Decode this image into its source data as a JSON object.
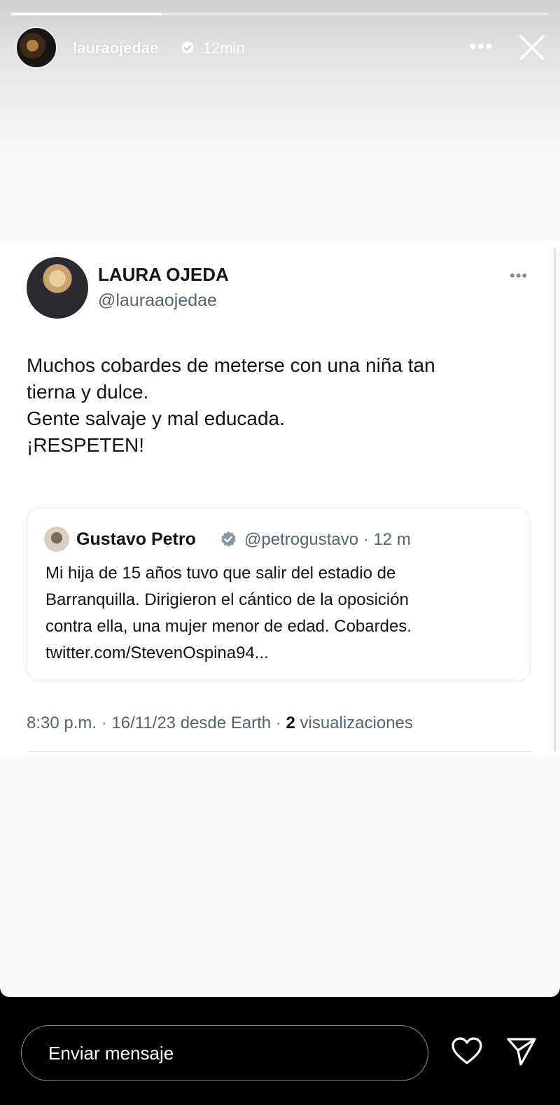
{
  "story": {
    "username": "lauraojedae",
    "time": "12min",
    "progress": 0.28,
    "more_icon": "more-horizontal-icon",
    "close_icon": "close-icon"
  },
  "tweet": {
    "author_name": "LAURA OJEDA",
    "author_handle": "@lauraaojedae",
    "text_lines": [
      "Muchos cobardes de meterse con una niña tan",
      "tierna y dulce.",
      "Gente salvaje y mal educada.",
      "¡RESPETEN!"
    ],
    "quote": {
      "name": "Gustavo Petro",
      "handle_time": "@petrogustavo · 12 m",
      "text_lines": [
        "Mi hija de 15 años tuvo que salir del estadio de",
        "Barranquilla. Dirigieron el cántico de la oposición",
        "contra ella, una mujer menor de edad. Cobardes.",
        "twitter.com/StevenOspina94..."
      ]
    },
    "meta_prefix": "8:30 p.m. · 16/11/23 desde Earth · ",
    "views_count": "2",
    "views_label": " visualizaciones"
  },
  "bottom": {
    "message_placeholder": "Enviar mensaje",
    "heart_icon": "heart-icon",
    "send_icon": "send-icon"
  },
  "colors": {
    "verified_blue": "#1d9bf0",
    "text_primary": "#0f1419",
    "text_secondary": "#536471"
  }
}
